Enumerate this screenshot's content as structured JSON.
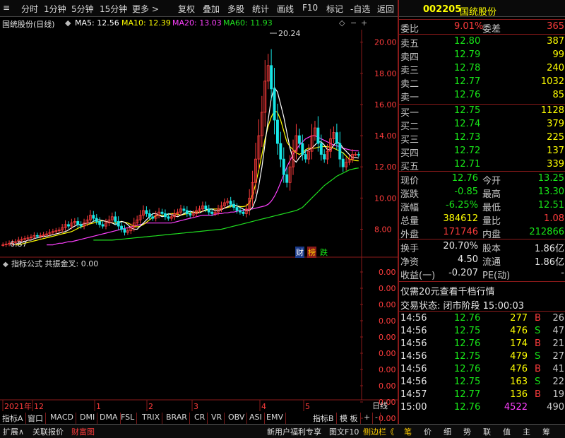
{
  "toolbar": {
    "left_items": [
      "分时",
      "1分钟",
      "5分钟",
      "15分钟",
      "更多 >"
    ],
    "right_items": [
      "复权",
      "叠加",
      "多股",
      "统计",
      "画线",
      "F10",
      "标记",
      "-自选",
      "返回"
    ]
  },
  "chart_header": {
    "title": "国统股份(日线)",
    "ma5": "MA5: 12.56",
    "ma10": "MA10: 12.39",
    "ma20": "MA20: 13.03",
    "ma60": "MA60: 11.93",
    "colors": {
      "ma5": "#ffffff",
      "ma10": "#ffff00",
      "ma20": "#ff40ff",
      "ma60": "#20e020"
    }
  },
  "chart_data": {
    "type": "candlestick",
    "y_ticks": [
      "20.00",
      "18.00",
      "16.00",
      "14.00",
      "12.00",
      "10.00",
      "8.00"
    ],
    "ylim": [
      6.3,
      20.8
    ],
    "high_label": "20.24",
    "low_label": "6.87",
    "x_labels": [
      "2021年",
      "12",
      "1",
      "2",
      "3",
      "4",
      "5"
    ],
    "period_label": "日线",
    "close": [
      7.0,
      7.05,
      7.1,
      7.15,
      7.2,
      7.3,
      7.35,
      7.4,
      7.45,
      7.5,
      7.6,
      7.55,
      7.6,
      7.65,
      7.7,
      7.8,
      7.85,
      7.9,
      7.95,
      8.1,
      8.3,
      8.2,
      8.4,
      8.5,
      8.3,
      8.2,
      8.4,
      8.6,
      8.9,
      8.7,
      8.5,
      8.3,
      8.2,
      8.4,
      8.6,
      8.8,
      8.5,
      8.2,
      8.0,
      7.8,
      7.9,
      8.1,
      8.4,
      8.6,
      8.9,
      9.2,
      9.0,
      8.8,
      8.7,
      8.9,
      9.1,
      9.0,
      8.8,
      8.7,
      8.8,
      9.0,
      9.1,
      9.3,
      9.2,
      9.0,
      8.9,
      9.0,
      9.2,
      9.3,
      9.5,
      9.3,
      9.1,
      9.0,
      9.1,
      9.3,
      9.5,
      9.7,
      9.8,
      9.6,
      9.4,
      9.2,
      9.1,
      9.0,
      9.3,
      10.0,
      11.0,
      12.5,
      14.0,
      15.5,
      17.5,
      18.5,
      17.0,
      15.0,
      13.5,
      12.5,
      11.5,
      11.0,
      12.0,
      13.0,
      14.0,
      13.5,
      12.8,
      12.5,
      13.0,
      14.0,
      14.5,
      13.5,
      12.8,
      12.5,
      13.0,
      13.8,
      14.2,
      13.5,
      12.5,
      12.0,
      12.3,
      12.5,
      12.8,
      12.8,
      12.76
    ],
    "ma5": [
      7.0,
      7.05,
      7.1,
      7.15,
      7.2,
      7.3,
      7.3,
      7.4,
      7.45,
      7.5,
      7.55,
      7.55,
      7.6,
      7.65,
      7.7,
      7.75,
      7.8,
      7.85,
      7.95,
      8.1,
      8.2,
      8.3,
      8.3,
      8.35,
      8.4,
      8.4,
      8.5,
      8.6,
      8.6,
      8.55,
      8.5,
      8.45,
      8.4,
      8.3,
      8.4,
      8.5,
      8.45,
      8.3,
      8.1,
      8.0,
      8.0,
      8.2,
      8.4,
      8.6,
      8.8,
      9.0,
      9.0,
      8.9,
      8.8,
      8.85,
      9.0,
      8.95,
      8.85,
      8.8,
      8.9,
      9.0,
      9.1,
      9.15,
      9.1,
      9.05,
      9.05,
      9.15,
      9.25,
      9.3,
      9.3,
      9.2,
      9.2,
      9.25,
      9.35,
      9.45,
      9.55,
      9.55,
      9.5,
      9.4,
      9.3,
      9.2,
      9.2,
      9.4,
      9.9,
      10.8,
      12.0,
      13.5,
      15.0,
      16.4,
      17.1,
      16.8,
      16.0,
      15.2,
      14.2,
      13.2,
      12.5,
      12.3,
      12.6,
      12.8,
      13.0,
      13.1,
      13.2,
      13.4,
      13.6,
      13.6,
      13.4,
      13.1,
      13.1,
      13.4,
      13.6,
      13.5,
      13.2,
      13.0,
      12.8,
      12.6,
      12.6,
      12.56
    ],
    "ma10": [
      7.0,
      7.0,
      7.05,
      7.1,
      7.15,
      7.2,
      7.25,
      7.3,
      7.35,
      7.4,
      7.45,
      7.5,
      7.55,
      7.6,
      7.65,
      7.7,
      7.75,
      7.8,
      7.85,
      7.95,
      8.05,
      8.15,
      8.2,
      8.3,
      8.35,
      8.4,
      8.45,
      8.5,
      8.55,
      8.5,
      8.45,
      8.4,
      8.4,
      8.45,
      8.5,
      8.45,
      8.4,
      8.3,
      8.2,
      8.15,
      8.2,
      8.3,
      8.45,
      8.6,
      8.75,
      8.85,
      8.9,
      8.9,
      8.9,
      8.95,
      9.0,
      9.0,
      8.95,
      8.9,
      8.95,
      9.0,
      9.05,
      9.1,
      9.1,
      9.1,
      9.15,
      9.2,
      9.25,
      9.3,
      9.3,
      9.3,
      9.3,
      9.35,
      9.4,
      9.45,
      9.5,
      9.5,
      9.45,
      9.45,
      9.5,
      9.7,
      10.2,
      10.9,
      11.8,
      12.8,
      13.8,
      14.6,
      15.2,
      15.6,
      15.5,
      15.0,
      14.3,
      13.6,
      13.3,
      13.1,
      12.9,
      12.8,
      12.9,
      13.1,
      13.2,
      13.2,
      13.2,
      13.25,
      13.3,
      13.3,
      13.3,
      13.25,
      13.2,
      13.1,
      13.0,
      12.9,
      12.7,
      12.5,
      12.45,
      12.4,
      12.39
    ],
    "ma20": [
      7.0,
      7.0,
      7.0,
      7.05,
      7.1,
      7.1,
      7.15,
      7.2,
      7.2,
      7.25,
      7.3,
      7.35,
      7.4,
      7.45,
      7.5,
      7.55,
      7.6,
      7.65,
      7.7,
      7.75,
      7.8,
      7.85,
      7.9,
      7.95,
      8.0,
      8.05,
      8.1,
      8.15,
      8.2,
      8.25,
      8.3,
      8.35,
      8.4,
      8.4,
      8.4,
      8.4,
      8.4,
      8.4,
      8.4,
      8.4,
      8.4,
      8.45,
      8.5,
      8.55,
      8.6,
      8.65,
      8.7,
      8.75,
      8.8,
      8.85,
      8.9,
      8.9,
      8.9,
      8.9,
      8.95,
      9.0,
      9.0,
      9.05,
      9.05,
      9.1,
      9.1,
      9.15,
      9.2,
      9.2,
      9.25,
      9.3,
      9.3,
      9.35,
      9.4,
      9.45,
      9.5,
      9.6,
      9.8,
      10.1,
      10.5,
      11.0,
      11.5,
      12.0,
      12.4,
      12.8,
      13.1,
      13.4,
      13.6,
      13.8,
      13.9,
      14.0,
      14.0,
      13.9,
      13.8,
      13.7,
      13.6,
      13.5,
      13.4,
      13.35,
      13.3,
      13.2,
      13.15,
      13.1,
      13.05,
      13.03,
      13.03
    ],
    "ma60": [
      7.3,
      7.3,
      7.3,
      7.3,
      7.3,
      7.3,
      7.3,
      7.32,
      7.34,
      7.36,
      7.38,
      7.4,
      7.42,
      7.44,
      7.46,
      7.48,
      7.5,
      7.52,
      7.54,
      7.56,
      7.58,
      7.6,
      7.62,
      7.64,
      7.66,
      7.68,
      7.7,
      7.72,
      7.74,
      7.76,
      7.78,
      7.8,
      7.82,
      7.84,
      7.86,
      7.88,
      7.9,
      7.92,
      7.94,
      7.96,
      7.98,
      8.0,
      8.05,
      8.1,
      8.15,
      8.2,
      8.25,
      8.3,
      8.35,
      8.4,
      8.45,
      8.5,
      8.55,
      8.6,
      8.65,
      8.7,
      8.75,
      8.8,
      8.85,
      8.9,
      8.95,
      9.0,
      9.05,
      9.1,
      9.15,
      9.2,
      9.3,
      9.4,
      9.6,
      9.8,
      10.0,
      10.2,
      10.4,
      10.6,
      10.8,
      10.95,
      11.1,
      11.25,
      11.4,
      11.5,
      11.6,
      11.7,
      11.8,
      11.85,
      11.9,
      11.93
    ]
  },
  "badges": [
    "财",
    "榜",
    "跌"
  ],
  "indicator": {
    "title": "指标公式  共振金叉: 0.00",
    "y_ticks": [
      "0.00",
      "0.00",
      "0.00",
      "0.00",
      "0.00",
      "0.00",
      "0.00",
      "0.00",
      "0.00",
      "0.00"
    ]
  },
  "quote": {
    "code": "002205",
    "name": "国统股份",
    "weibi_label": "委比",
    "weibi": "9.01%",
    "weicha_label": "委差",
    "weicha": "365",
    "asks": [
      {
        "label": "卖五",
        "price": "12.80",
        "vol": "387"
      },
      {
        "label": "卖四",
        "price": "12.79",
        "vol": "99"
      },
      {
        "label": "卖三",
        "price": "12.78",
        "vol": "240"
      },
      {
        "label": "卖二",
        "price": "12.77",
        "vol": "1032"
      },
      {
        "label": "卖一",
        "price": "12.76",
        "vol": "85"
      }
    ],
    "bids": [
      {
        "label": "买一",
        "price": "12.75",
        "vol": "1128"
      },
      {
        "label": "买二",
        "price": "12.74",
        "vol": "379"
      },
      {
        "label": "买三",
        "price": "12.73",
        "vol": "225"
      },
      {
        "label": "买四",
        "price": "12.72",
        "vol": "137"
      },
      {
        "label": "买五",
        "price": "12.71",
        "vol": "339"
      }
    ],
    "stats": [
      {
        "l1": "现价",
        "v1": "12.76",
        "c1": "green",
        "l2": "今开",
        "v2": "13.25",
        "c2": "green"
      },
      {
        "l1": "涨跌",
        "v1": "-0.85",
        "c1": "green",
        "l2": "最高",
        "v2": "13.30",
        "c2": "green"
      },
      {
        "l1": "涨幅",
        "v1": "-6.25%",
        "c1": "green",
        "l2": "最低",
        "v2": "12.51",
        "c2": "green"
      },
      {
        "l1": "总量",
        "v1": "384612",
        "c1": "yellow",
        "l2": "量比",
        "v2": "1.08",
        "c2": "red"
      },
      {
        "l1": "外盘",
        "v1": "171746",
        "c1": "red",
        "l2": "内盘",
        "v2": "212866",
        "c2": "green"
      }
    ],
    "fin": [
      {
        "l1": "换手",
        "v1": "20.70%",
        "l2": "股本",
        "v2": "1.86亿"
      },
      {
        "l1": "净资",
        "v1": "4.50",
        "l2": "流通",
        "v2": "1.86亿"
      },
      {
        "l1": "收益(一)",
        "v1": "-0.207",
        "l2": "PE(动)",
        "v2": "-"
      }
    ],
    "promo": "仅需20元查看千档行情",
    "trade_status": "交易状态: 闭市阶段 15:00:03",
    "ticks": [
      {
        "t": "14:56",
        "p": "12.76",
        "v": "277",
        "s": "B",
        "n": "26"
      },
      {
        "t": "14:56",
        "p": "12.75",
        "v": "476",
        "s": "S",
        "n": "47"
      },
      {
        "t": "14:56",
        "p": "12.76",
        "v": "174",
        "s": "B",
        "n": "21"
      },
      {
        "t": "14:56",
        "p": "12.75",
        "v": "479",
        "s": "S",
        "n": "27"
      },
      {
        "t": "14:56",
        "p": "12.76",
        "v": "476",
        "s": "B",
        "n": "41"
      },
      {
        "t": "14:56",
        "p": "12.75",
        "v": "163",
        "s": "S",
        "n": "22"
      },
      {
        "t": "14:57",
        "p": "12.77",
        "v": "136",
        "s": "B",
        "n": "19"
      },
      {
        "t": "15:00",
        "p": "12.76",
        "v": "4522",
        "s": "",
        "n": "490"
      }
    ]
  },
  "tabs": [
    "指标A",
    "窗口",
    "MACD",
    "DMI",
    "DMA",
    "FSL",
    "TRIX",
    "BRAR",
    "CR",
    "VR",
    "OBV",
    "ASI",
    "EMV",
    "指标B",
    "模 板",
    "+",
    "-"
  ],
  "status": {
    "left": [
      "扩展∧",
      "关联报价",
      "财富图"
    ],
    "middle": [
      "新用户福利专享",
      "图文F10",
      "侧边栏《"
    ],
    "right": [
      "笔",
      "价",
      "细",
      "势",
      "联",
      "值",
      "主",
      "筹"
    ]
  }
}
